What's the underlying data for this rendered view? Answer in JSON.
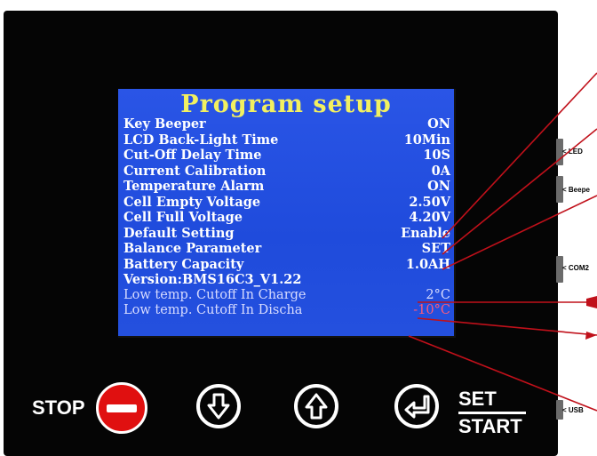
{
  "screen": {
    "title": "Program setup",
    "rows": [
      {
        "label": "Key Beeper",
        "value": "ON"
      },
      {
        "label": "LCD Back-Light Time",
        "value": "10Min"
      },
      {
        "label": "Cut-Off Delay Time",
        "value": "10S"
      },
      {
        "label": "Current Calibration",
        "value": "0A"
      },
      {
        "label": "Temperature Alarm",
        "value": "ON"
      },
      {
        "label": "Cell Empty Voltage",
        "value": "2.50V"
      },
      {
        "label": "Cell Full Voltage",
        "value": "4.20V"
      },
      {
        "label": "Default Setting",
        "value": "Enable"
      },
      {
        "label": "Balance Parameter",
        "value": "SET"
      },
      {
        "label": "Battery Capacity",
        "value": "1.0AH"
      },
      {
        "label": "Version:BMS16C3_V1.22",
        "value": ""
      },
      {
        "label": "Low temp. Cutoff In Charge",
        "value": "2°C"
      },
      {
        "label": "Low temp. Cutoff In Discha",
        "value": "-10°C"
      }
    ]
  },
  "ports": {
    "led": "< LED",
    "beeper": "< Beepe",
    "com2": "< COM2",
    "usb": "< USB"
  },
  "buttons": {
    "stop": "STOP",
    "set": "SET",
    "start": "START"
  },
  "colors": {
    "lcd_background": "#1f4ee0",
    "title": "#f2f060",
    "annotation_lines": "#c0101a"
  }
}
